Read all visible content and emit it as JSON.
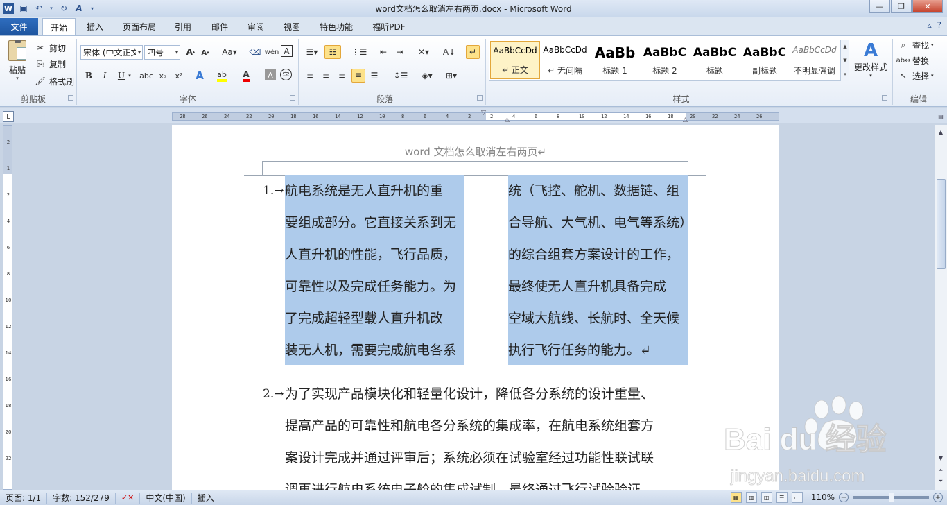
{
  "title": {
    "text": "word文档怎么取消左右两页.docx - Microsoft Word"
  },
  "qat": {
    "logo": "W"
  },
  "tabs": {
    "file": "文件",
    "items": [
      "开始",
      "插入",
      "页面布局",
      "引用",
      "邮件",
      "审阅",
      "视图",
      "特色功能",
      "福昕PDF"
    ]
  },
  "clipboard": {
    "paste": "粘贴",
    "cut": "剪切",
    "copy": "复制",
    "format_painter": "格式刷",
    "label": "剪贴板"
  },
  "font": {
    "name": "宋体 (中文正文)",
    "size": "四号",
    "label": "字体",
    "bold": "B",
    "italic": "I",
    "underline": "U",
    "strike": "abc",
    "sub": "x₂",
    "sup": "x²"
  },
  "paragraph": {
    "label": "段落"
  },
  "styles": {
    "label": "样式",
    "items": [
      {
        "preview": "AaBbCcDd",
        "name": "↵ 正文"
      },
      {
        "preview": "AaBbCcDd",
        "name": "↵ 无间隔"
      },
      {
        "preview": "AaBb",
        "name": "标题 1"
      },
      {
        "preview": "AaBbC",
        "name": "标题 2"
      },
      {
        "preview": "AaBbC",
        "name": "标题"
      },
      {
        "preview": "AaBbC",
        "name": "副标题"
      },
      {
        "preview": "AaBbCcDd",
        "name": "不明显强调"
      }
    ],
    "change": "更改样式"
  },
  "editing": {
    "find": "查找",
    "replace": "替换",
    "select": "选择",
    "label": "编辑"
  },
  "ruler": {
    "h_ticks": [
      "28",
      "26",
      "24",
      "22",
      "20",
      "18",
      "16",
      "14",
      "12",
      "10",
      "8",
      "6",
      "4",
      "2",
      "2",
      "4",
      "6",
      "8",
      "10",
      "12",
      "14",
      "16",
      "18",
      "20",
      "22",
      "24",
      "26"
    ],
    "v_ticks": [
      "2",
      "1",
      "2",
      "4",
      "6",
      "8",
      "10",
      "12",
      "14",
      "16",
      "18",
      "20",
      "22"
    ]
  },
  "document": {
    "header": "word 文档怎么取消左右两页↵",
    "item1_number": "1.→",
    "col_left": [
      "航电系统是无人直升机的重",
      "要组成部分。它直接关系到无",
      "人直升机的性能，飞行品质，",
      "可靠性以及完成任务能力。为",
      "了完成超轻型载人直升机改",
      "装无人机，需要完成航电各系"
    ],
    "col_right": [
      "统（飞控、舵机、数据链、组",
      "合导航、大气机、电气等系统）",
      "的综合组套方案设计的工作，",
      "最终使无人直升机具备完成",
      "空域大航线、长航时、全天候",
      "执行飞行任务的能力。↵"
    ],
    "item2_number": "2.→",
    "item2_lines": [
      "为了实现产品模块化和轻量化设计，降低各分系统的设计重量、",
      "提高产品的可靠性和航电各分系统的集成率，在航电系统组套方",
      "案设计完成并通过评审后；系统必须在试验室经过功能性联试联",
      "调再进行航电系统电子舱的集成试制，最终通过飞行试验验证"
    ]
  },
  "status": {
    "page": "页面: 1/1",
    "words": "字数: 152/279",
    "lang": "中文(中国)",
    "mode": "插入",
    "zoom": "110%"
  },
  "zoom_level": 110,
  "watermark": {
    "brand": "Bai du 经验",
    "url": "jingyan.baidu.com"
  },
  "colors": {
    "selection": "#aecbeb",
    "file_tab": "#1e559f",
    "highlight": "#fde28a"
  }
}
